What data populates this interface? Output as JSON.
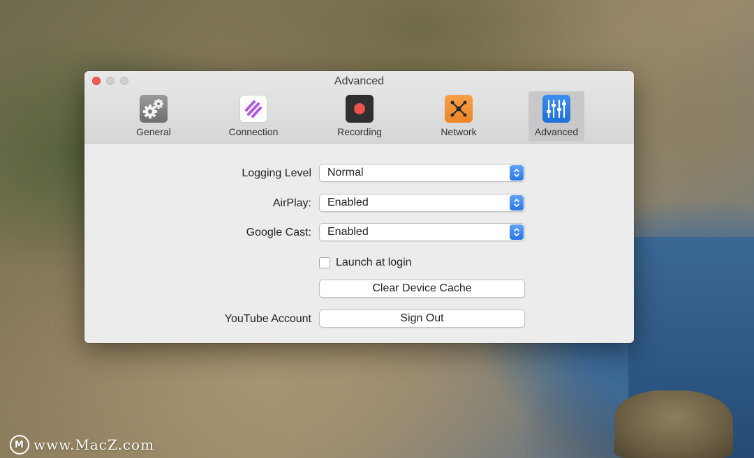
{
  "window": {
    "title": "Advanced"
  },
  "toolbar": {
    "items": [
      {
        "label": "General",
        "icon": "gears-icon",
        "selected": false
      },
      {
        "label": "Connection",
        "icon": "connection-stripes-icon",
        "selected": false
      },
      {
        "label": "Recording",
        "icon": "record-icon",
        "selected": false
      },
      {
        "label": "Network",
        "icon": "network-nodes-icon",
        "selected": false
      },
      {
        "label": "Advanced",
        "icon": "sliders-icon",
        "selected": true
      }
    ]
  },
  "settings": {
    "logging_level": {
      "label": "Logging Level",
      "value": "Normal"
    },
    "airplay": {
      "label": "AirPlay:",
      "value": "Enabled"
    },
    "google_cast": {
      "label": "Google Cast:",
      "value": "Enabled"
    },
    "launch_at_login": {
      "label": "Launch at login",
      "checked": false
    },
    "clear_cache": {
      "label": "Clear Device Cache"
    },
    "youtube": {
      "label": "YouTube Account",
      "button": "Sign Out"
    }
  },
  "watermark": {
    "text": "www.MacZ.com"
  },
  "colors": {
    "accent": "#2a76e5",
    "close": "#ee5d55",
    "network_icon": "#ee8526",
    "recording_dot": "#e8534e"
  }
}
